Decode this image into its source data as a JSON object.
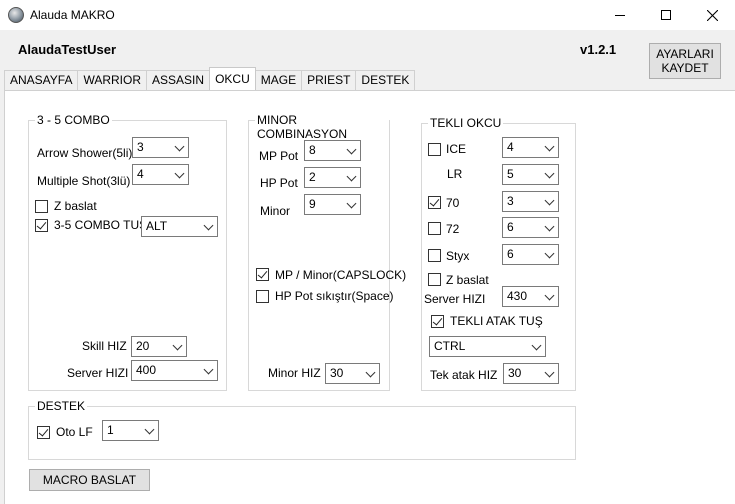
{
  "window": {
    "title": "Alauda MAKRO",
    "minimize_icon": "minimize-icon",
    "maximize_icon": "maximize-icon",
    "close_icon": "close-icon"
  },
  "header": {
    "user": "AlaudaTestUser",
    "version": "v1.2.1",
    "save_label_line1": "AYARLARI",
    "save_label_line2": "KAYDET"
  },
  "tabs": [
    {
      "label": "ANASAYFA"
    },
    {
      "label": "WARRIOR"
    },
    {
      "label": "ASSASIN"
    },
    {
      "label": "OKCU",
      "active": true
    },
    {
      "label": "MAGE"
    },
    {
      "label": "PRIEST"
    },
    {
      "label": "DESTEK"
    }
  ],
  "combo35": {
    "title": "3 - 5 COMBO",
    "arrow_shower_label": "Arrow Shower(5li)",
    "arrow_shower_value": "3",
    "multiple_shot_label": "Multiple Shot(3lü)",
    "multiple_shot_value": "4",
    "z_baslat_label": "Z baslat",
    "z_baslat_checked": false,
    "combo_tus_label": "3-5 COMBO TUS",
    "combo_tus_checked": true,
    "combo_tus_value": "ALT",
    "skill_hiz_label": "Skill HIZ",
    "skill_hiz_value": "20",
    "server_hizi_label": "Server HIZI",
    "server_hizi_value": "400"
  },
  "minor": {
    "title": "MINOR COMBINASYON",
    "mp_pot_label": "MP Pot",
    "mp_pot_value": "8",
    "hp_pot_label": "HP Pot",
    "hp_pot_value": "2",
    "minor_label": "Minor",
    "minor_value": "9",
    "mp_minor_label": "MP / Minor(CAPSLOCK)",
    "mp_minor_checked": true,
    "hp_pot_sik_label": "HP Pot sıkıştır(Space)",
    "hp_pot_sik_checked": false,
    "minor_hiz_label": "Minor HIZ",
    "minor_hiz_value": "30"
  },
  "tekli": {
    "title": "TEKLI OKCU",
    "ice_label": "ICE",
    "ice_checked": false,
    "ice_value": "4",
    "lr_label": "LR",
    "lr_value": "5",
    "s70_label": "70",
    "s70_checked": true,
    "s70_value": "3",
    "s72_label": "72",
    "s72_checked": false,
    "s72_value": "6",
    "styx_label": "Styx",
    "styx_checked": false,
    "styx_value": "6",
    "z_baslat_label": "Z baslat",
    "z_baslat_checked": false,
    "server_hizi_label": "Server HIZI",
    "server_hizi_value": "430",
    "atak_tus_label": "TEKLI ATAK  TUŞ",
    "atak_tus_checked": true,
    "atak_tus_value": "CTRL",
    "tek_atak_hiz_label": "Tek atak HIZ",
    "tek_atak_hiz_value": "30"
  },
  "destek": {
    "title": "DESTEK",
    "oto_lf_label": "Oto LF",
    "oto_lf_checked": true,
    "oto_lf_value": "1"
  },
  "footer": {
    "macro_button_label": "MACRO BASLAT"
  }
}
